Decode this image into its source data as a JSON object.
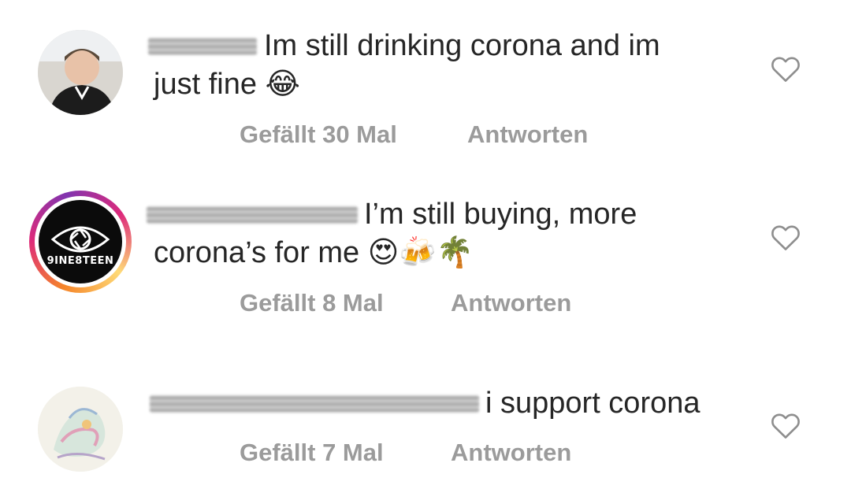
{
  "comments": [
    {
      "line1": "Im still drinking corona and im",
      "line2": "just fine 😂",
      "likes": "Gefällt 30 Mal",
      "reply": "Antworten"
    },
    {
      "line1": "I’m still buying, more",
      "line2": "corona’s for me 😍🍻🌴",
      "likes": "Gefällt 8 Mal",
      "reply": "Antworten",
      "avatar_logo_text": "9INE8TEEN"
    },
    {
      "line1": "i support corona",
      "likes": "Gefällt 7 Mal",
      "reply": "Antworten"
    }
  ],
  "icons": {
    "like": "heart-outline-icon"
  },
  "colors": {
    "text": "#262626",
    "meta": "#9b9b9b",
    "heart_stroke": "#8e8e8e"
  }
}
